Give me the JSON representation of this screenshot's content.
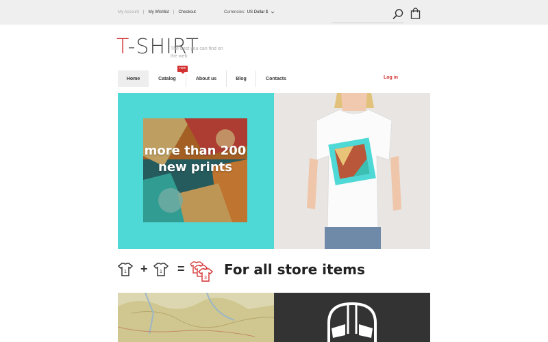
{
  "topbar": {
    "links": {
      "my_account": "My Account",
      "my_wishlist": "My Wishlist",
      "checkout": "Checkout"
    },
    "separator": "|",
    "currency": {
      "label": "Currencies:",
      "value": "US Dollar $"
    },
    "icons": {
      "search": "search-icon",
      "cart": "shopping-bag-icon"
    }
  },
  "logo": {
    "first_letter": "T",
    "rest": "-SHIRT",
    "tagline": "The best you can find on the web"
  },
  "nav": {
    "items": [
      {
        "label": "Home"
      },
      {
        "label": "Catalog"
      },
      {
        "label": "About us"
      },
      {
        "label": "Blog"
      },
      {
        "label": "Contacts"
      }
    ],
    "badge": "new",
    "login": "Log in"
  },
  "hero": {
    "text": "more than 200 new prints"
  },
  "promo": {
    "shirt_1": "1",
    "plus": "+",
    "shirt_2": "1",
    "equals": "=",
    "shirt_3": "3",
    "text": "For all store items"
  },
  "colors": {
    "accent": "#d32f2f",
    "hero_bg": "#4fd9d6",
    "topbar_bg": "#efefef",
    "dark_tile": "#333333"
  }
}
